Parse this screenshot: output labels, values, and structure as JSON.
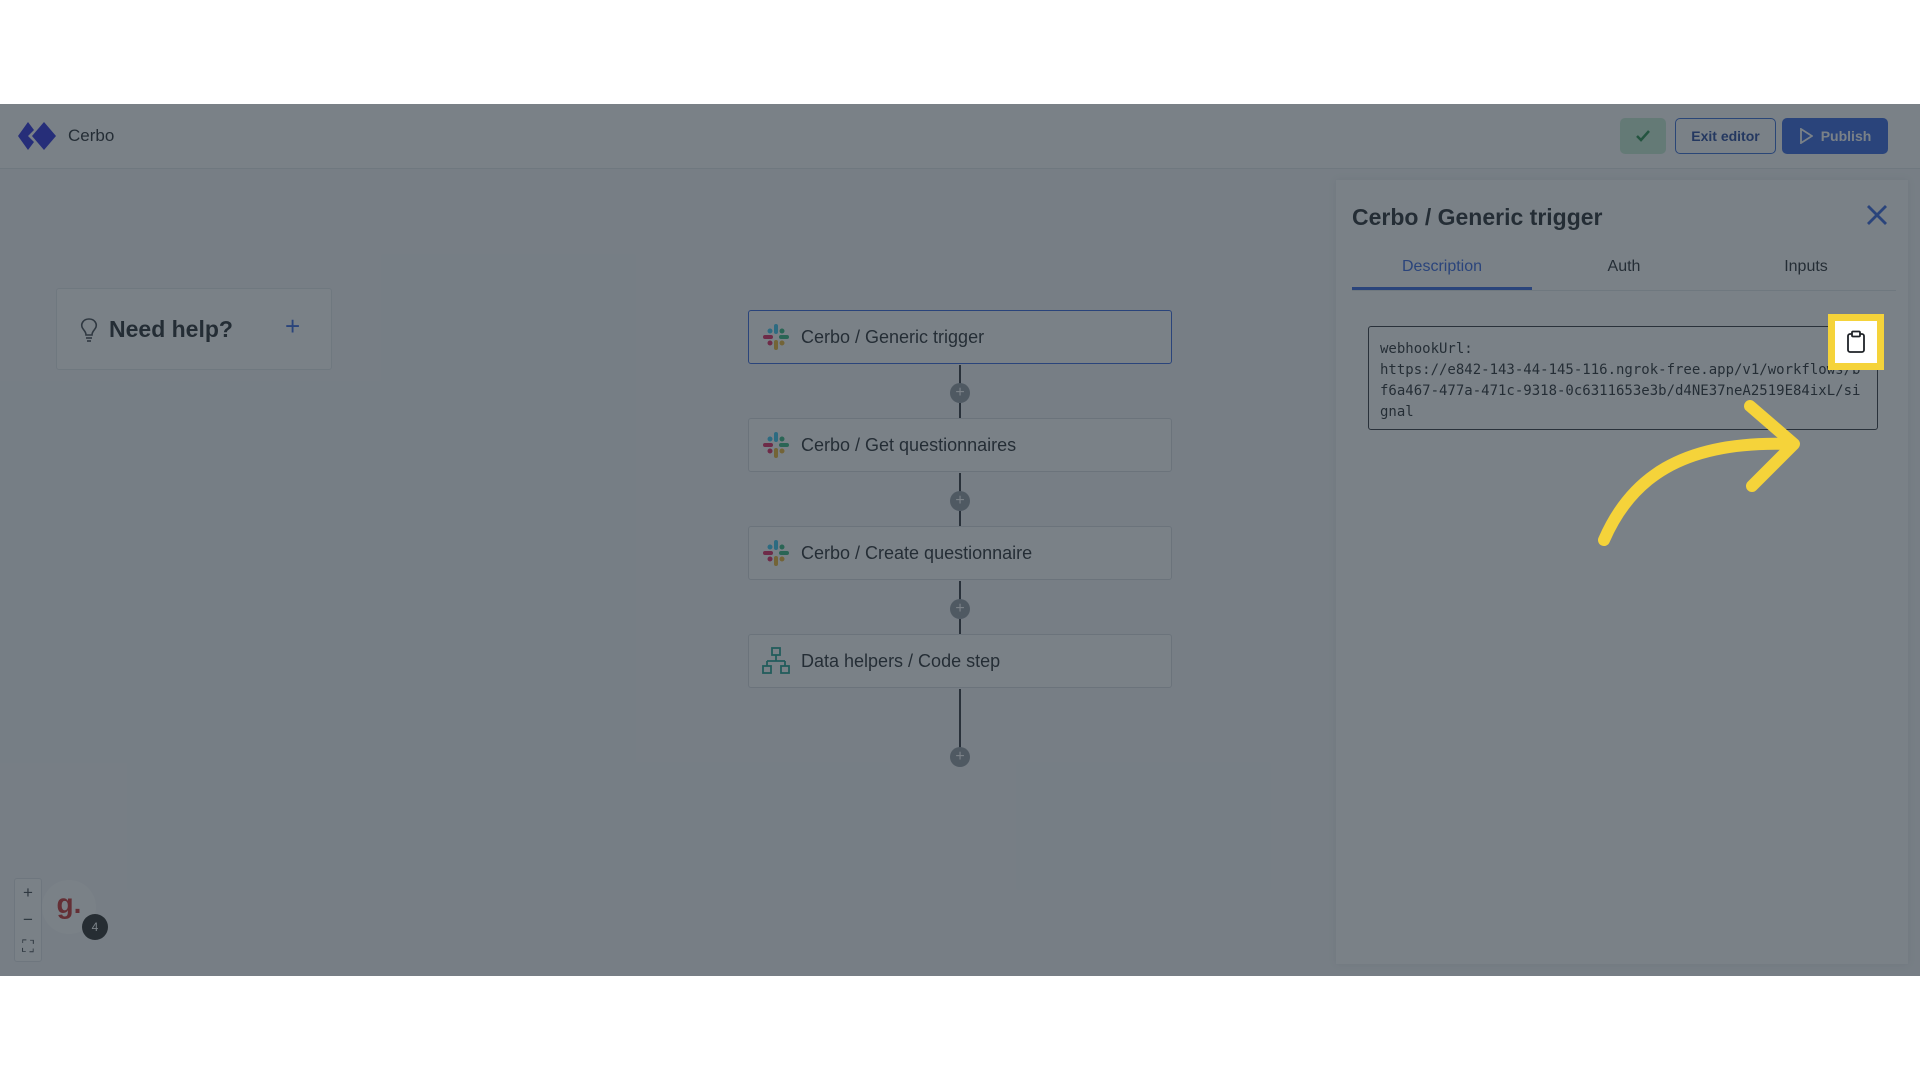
{
  "header": {
    "app_name": "Cerbo",
    "exit_label": "Exit editor",
    "publish_label": "Publish"
  },
  "help": {
    "label": "Need help?",
    "plus": "+"
  },
  "flow": {
    "steps": [
      {
        "label": "Cerbo / Generic trigger",
        "icon": "slack-icon"
      },
      {
        "label": "Cerbo / Get questionnaires",
        "icon": "slack-icon"
      },
      {
        "label": "Cerbo / Create questionnaire",
        "icon": "slack-icon"
      },
      {
        "label": "Data helpers / Code step",
        "icon": "flow-tree-icon"
      }
    ],
    "add_symbol": "+"
  },
  "zoom": {
    "in": "+",
    "out": "−",
    "fit": "⛶"
  },
  "avatar": {
    "letter": "g.",
    "badge_count": "4"
  },
  "panel": {
    "title": "Cerbo / Generic trigger",
    "tabs": [
      "Description",
      "Auth",
      "Inputs"
    ],
    "active_tab": "Description",
    "code": "webhookUrl:\nhttps://e842-143-44-145-116.ngrok-free.app/v1/workflows/bf6a467-477a-471c-9318-0c6311653e3b/d4NE37neA2519E84ixL/signal"
  },
  "colors": {
    "accent": "#2d5fe0",
    "highlight": "#f5d33a",
    "check_bg": "#c5ecd2"
  }
}
